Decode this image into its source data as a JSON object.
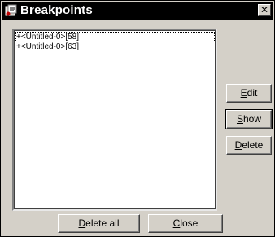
{
  "window": {
    "title": "Breakpoints",
    "close_glyph": "✕"
  },
  "breakpoints": {
    "items": [
      {
        "label": "+<Untitled-0>[58]",
        "selected": true
      },
      {
        "label": "+<Untitled-0>[63]",
        "selected": false
      }
    ]
  },
  "buttons": {
    "edit": {
      "label": "Edit",
      "mnemonic": "E",
      "rest": "dit"
    },
    "show": {
      "label": "Show",
      "mnemonic": "S",
      "rest": "how"
    },
    "delete": {
      "label": "Delete",
      "mnemonic": "D",
      "rest": "elete"
    },
    "delete_all": {
      "label": "Delete all",
      "mnemonic": "D",
      "rest": "elete all"
    },
    "close": {
      "label": "Close",
      "mnemonic": "C",
      "rest": "lose"
    }
  },
  "icons": {
    "title": "breakpoints-window-icon",
    "close": "close-icon"
  },
  "colors": {
    "titlebar": "#000000",
    "face": "#d4d0c8",
    "list_bg": "#ffffff"
  }
}
